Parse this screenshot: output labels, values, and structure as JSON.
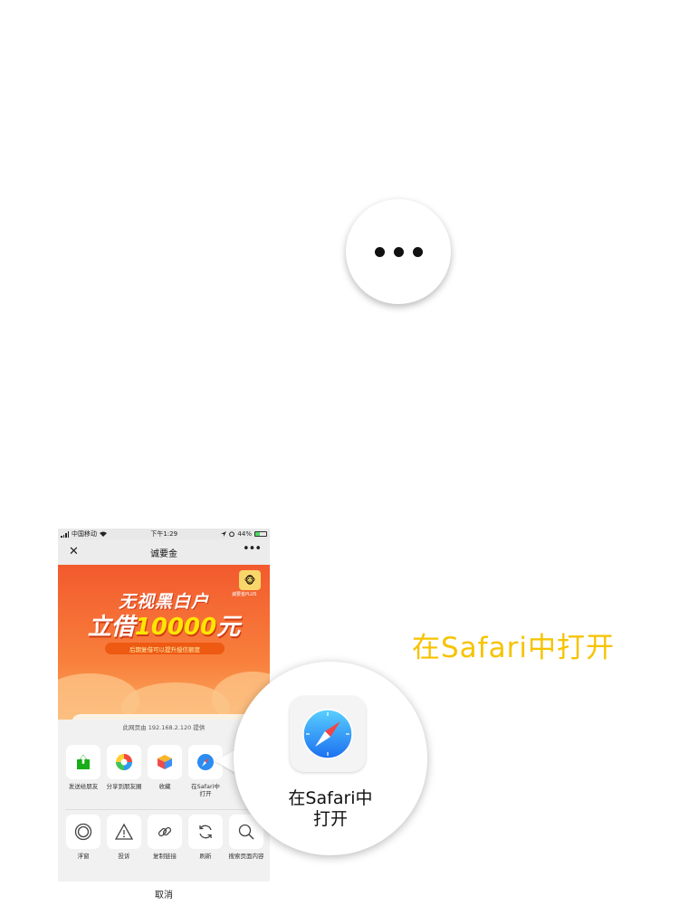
{
  "more_button": {
    "icon": "more-dots-icon"
  },
  "hint_text": "在Safari中打开",
  "status_bar": {
    "carrier": "中国移动",
    "time": "下午1:29",
    "battery": "44%",
    "battery_level": 0.44
  },
  "nav": {
    "title": "诚要金",
    "close_icon": "close-icon",
    "menu_icon": "more-dots-icon"
  },
  "banner": {
    "brand": "诚要金PLUS",
    "headline": "无视黑白户",
    "subline_prefix": "立借",
    "amount": "10000",
    "unit": "元",
    "pill": "后期复借可以提升授信额度",
    "card_icons": [
      "lightning-icon",
      "heart-icon",
      "shield-check-icon"
    ]
  },
  "share_sheet": {
    "source_info": "此网页由 192.168.2.120 提供",
    "row1": [
      {
        "label": "发送给朋友",
        "icon": "send-to-friend-icon"
      },
      {
        "label": "分享到朋友圈",
        "icon": "moments-icon"
      },
      {
        "label": "收藏",
        "icon": "favorites-cube-icon"
      },
      {
        "label": "在Safari中\n打开",
        "icon": "safari-icon"
      }
    ],
    "row2": [
      {
        "label": "浮窗",
        "icon": "float-window-icon"
      },
      {
        "label": "投诉",
        "icon": "warning-icon"
      },
      {
        "label": "复制链接",
        "icon": "link-icon"
      },
      {
        "label": "刷新",
        "icon": "refresh-icon"
      },
      {
        "label": "搜索页面内容",
        "icon": "search-icon"
      }
    ],
    "cancel": "取消"
  },
  "zoom_callout": {
    "label_line1": "在Safari中",
    "label_line2": "打开",
    "icon": "safari-icon"
  },
  "colors": {
    "hint": "#f6c300",
    "banner_top": "#f25a2e",
    "banner_bottom": "#fbb267",
    "amount": "#ffe600"
  }
}
